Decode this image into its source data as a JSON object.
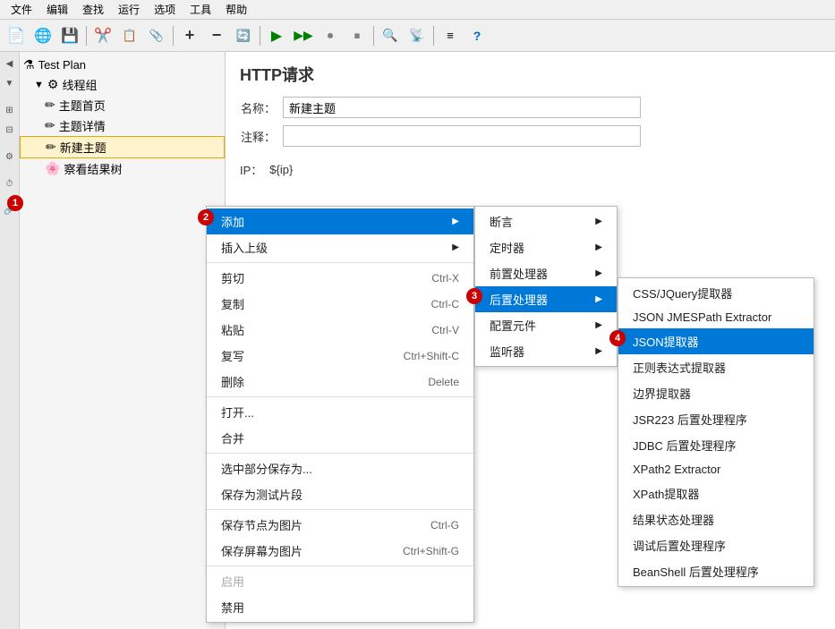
{
  "menubar": {
    "items": [
      "文件",
      "编辑",
      "查找",
      "运行",
      "选项",
      "工具",
      "帮助"
    ]
  },
  "toolbar": {
    "buttons": [
      "📄",
      "🌐",
      "💾",
      "✂️",
      "📋",
      "📎",
      "➕",
      "➖",
      "🔄",
      "▶️",
      "⏩",
      "⏺",
      "⏹",
      "🔍",
      "📡",
      "✏️",
      "❓"
    ]
  },
  "sidebar": {
    "test_plan_label": "Test Plan",
    "thread_group_label": "线程组",
    "items": [
      {
        "label": "主题首页",
        "icon": "✏️",
        "indent": 2
      },
      {
        "label": "主题详情",
        "icon": "✏️",
        "indent": 2
      },
      {
        "label": "新建主题",
        "icon": "✏️",
        "indent": 2,
        "selected": true
      },
      {
        "label": "察看结果树",
        "icon": "🌸",
        "indent": 2
      }
    ]
  },
  "content": {
    "title": "HTTP请求",
    "name_label": "名称：",
    "name_value": "新建主题",
    "comment_label": "注释：",
    "ip_label": "IP：",
    "ip_value": "${ip}"
  },
  "context_menu_main": {
    "items": [
      {
        "label": "添加",
        "shortcut": "",
        "has_arrow": true,
        "active": true
      },
      {
        "label": "插入上级",
        "shortcut": "",
        "has_arrow": true
      },
      {
        "label": "",
        "sep": true
      },
      {
        "label": "剪切",
        "shortcut": "Ctrl-X"
      },
      {
        "label": "复制",
        "shortcut": "Ctrl-C"
      },
      {
        "label": "粘贴",
        "shortcut": "Ctrl-V"
      },
      {
        "label": "复写",
        "shortcut": "Ctrl+Shift-C"
      },
      {
        "label": "删除",
        "shortcut": "Delete"
      },
      {
        "label": "",
        "sep": true
      },
      {
        "label": "打开..."
      },
      {
        "label": "合并"
      },
      {
        "label": "",
        "sep": true
      },
      {
        "label": "选中部分保存为..."
      },
      {
        "label": "保存为测试片段"
      },
      {
        "label": "",
        "sep": true
      },
      {
        "label": "保存节点为图片",
        "shortcut": "Ctrl-G"
      },
      {
        "label": "保存屏幕为图片",
        "shortcut": "Ctrl+Shift-G"
      },
      {
        "label": "",
        "sep": true
      },
      {
        "label": "启用",
        "disabled": true
      },
      {
        "label": "禁用"
      }
    ]
  },
  "submenu_add": {
    "items": [
      {
        "label": "断言",
        "has_arrow": true
      },
      {
        "label": "定时器",
        "has_arrow": true
      },
      {
        "label": "前置处理器",
        "has_arrow": true
      },
      {
        "label": "后置处理器",
        "has_arrow": true,
        "active": true
      },
      {
        "label": "配置元件",
        "has_arrow": true
      },
      {
        "label": "监听器",
        "has_arrow": true
      }
    ]
  },
  "submenu_post_processor": {
    "items": [
      {
        "label": "CSS/JQuery提取器"
      },
      {
        "label": "JSON JMESPath Extractor"
      },
      {
        "label": "JSON提取器",
        "active": true
      },
      {
        "label": "正则表达式提取器"
      },
      {
        "label": "边界提取器"
      },
      {
        "label": "JSR223 后置处理程序"
      },
      {
        "label": "JDBC 后置处理程序"
      },
      {
        "label": "XPath2 Extractor"
      },
      {
        "label": "XPath提取器"
      },
      {
        "label": "结果状态处理器"
      },
      {
        "label": "调试后置处理程序"
      },
      {
        "label": "BeanShell 后置处理程序"
      }
    ]
  },
  "badges": {
    "b1": "1",
    "b2": "2",
    "b3": "3",
    "b4": "4"
  }
}
